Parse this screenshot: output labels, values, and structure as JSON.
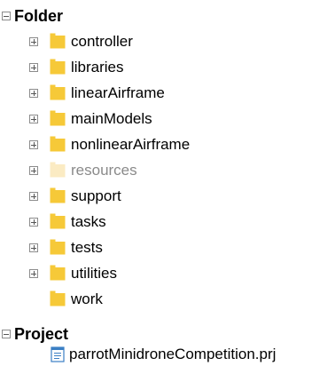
{
  "sections": {
    "folder": {
      "label": "Folder",
      "expanded": true
    },
    "project": {
      "label": "Project",
      "expanded": true
    }
  },
  "folders": [
    {
      "label": "controller",
      "expandable": true,
      "dimmed": false
    },
    {
      "label": "libraries",
      "expandable": true,
      "dimmed": false
    },
    {
      "label": "linearAirframe",
      "expandable": true,
      "dimmed": false
    },
    {
      "label": "mainModels",
      "expandable": true,
      "dimmed": false
    },
    {
      "label": "nonlinearAirframe",
      "expandable": true,
      "dimmed": false
    },
    {
      "label": "resources",
      "expandable": true,
      "dimmed": true
    },
    {
      "label": "support",
      "expandable": true,
      "dimmed": false
    },
    {
      "label": "tasks",
      "expandable": true,
      "dimmed": false
    },
    {
      "label": "tests",
      "expandable": true,
      "dimmed": false
    },
    {
      "label": "utilities",
      "expandable": true,
      "dimmed": false
    },
    {
      "label": "work",
      "expandable": false,
      "dimmed": false
    }
  ],
  "project_file": {
    "label": "parrotMinidroneCompetition.prj",
    "icon": "project-file-icon"
  },
  "colors": {
    "folder": "#F6C938",
    "folder_dim": "#FBEBC3",
    "text_dim": "#8A8A8A",
    "project_icon_blue": "#3B7FC4"
  }
}
